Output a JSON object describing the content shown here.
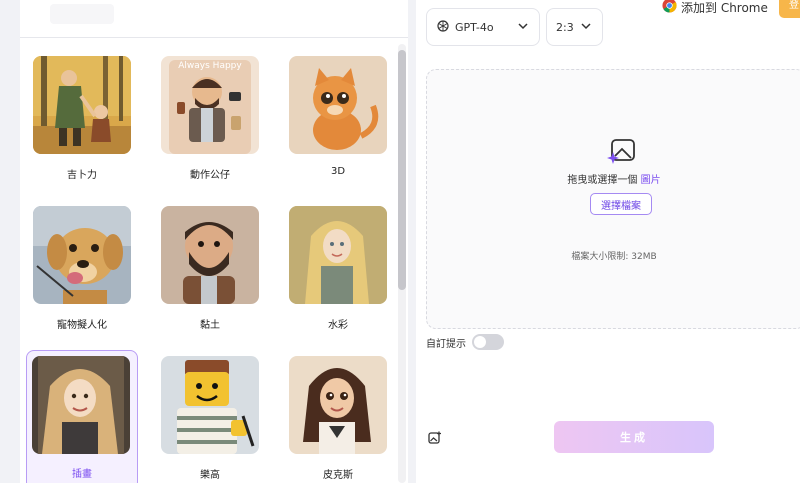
{
  "style_cards": [
    {
      "label": "吉卜力"
    },
    {
      "label": "動作公仔"
    },
    {
      "label": "3D"
    },
    {
      "label": "寵物擬人化"
    },
    {
      "label": "黏土"
    },
    {
      "label": "水彩"
    },
    {
      "label": "插畫",
      "selected": true
    },
    {
      "label": "樂高"
    },
    {
      "label": "皮克斯"
    }
  ],
  "action_figure_box_text": "Always Happy",
  "model_select": {
    "value": "GPT-4o",
    "icon": "openai-icon"
  },
  "ratio_select": {
    "value": "2:3"
  },
  "upload": {
    "prompt": "拖曳或選擇一個",
    "link": "圖片",
    "button": "選擇檔案",
    "size_limit": "檔案大小限制: 32MB"
  },
  "custom_prompt": {
    "label": "自訂提示",
    "enabled": false
  },
  "generate_label": "生成",
  "chrome_extension": {
    "label": "添加到 Chrome"
  },
  "top_right_button": "登",
  "colors": {
    "accent": "#7b4ef0",
    "generate_gradient_start": "#eec6f2",
    "generate_gradient_end": "#d8c5fb",
    "orange": "#f7b64a"
  }
}
